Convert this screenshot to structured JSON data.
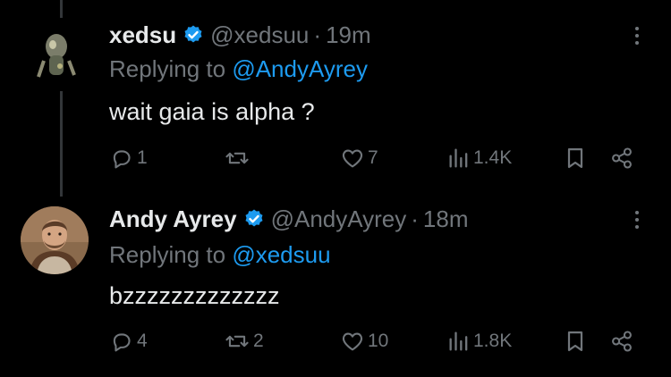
{
  "tweets": [
    {
      "name": "xedsu",
      "handle": "@xedsuu",
      "separator": "·",
      "time": "19m",
      "replying_prefix": "Replying to",
      "replying_to": "@AndyAyrey",
      "text": "wait gaia is alpha ?",
      "stats": {
        "replies": "1",
        "retweets": "",
        "likes": "7",
        "views": "1.4K"
      }
    },
    {
      "name": "Andy Ayrey",
      "handle": "@AndyAyrey",
      "separator": "·",
      "time": "18m",
      "replying_prefix": "Replying to",
      "replying_to": "@xedsuu",
      "text": "bzzzzzzzzzzzzz",
      "stats": {
        "replies": "4",
        "retweets": "2",
        "likes": "10",
        "views": "1.8K"
      }
    }
  ],
  "icons": {
    "verified": "verified-badge-icon",
    "reply": "reply-icon",
    "retweet": "retweet-icon",
    "like": "heart-icon",
    "views": "views-bar-chart-icon",
    "bookmark": "bookmark-icon",
    "share": "share-icon",
    "more": "more-vertical-icon"
  },
  "colors": {
    "background": "#000000",
    "text": "#e7e9ea",
    "muted": "#71767b",
    "accent": "#1d9bf0"
  }
}
